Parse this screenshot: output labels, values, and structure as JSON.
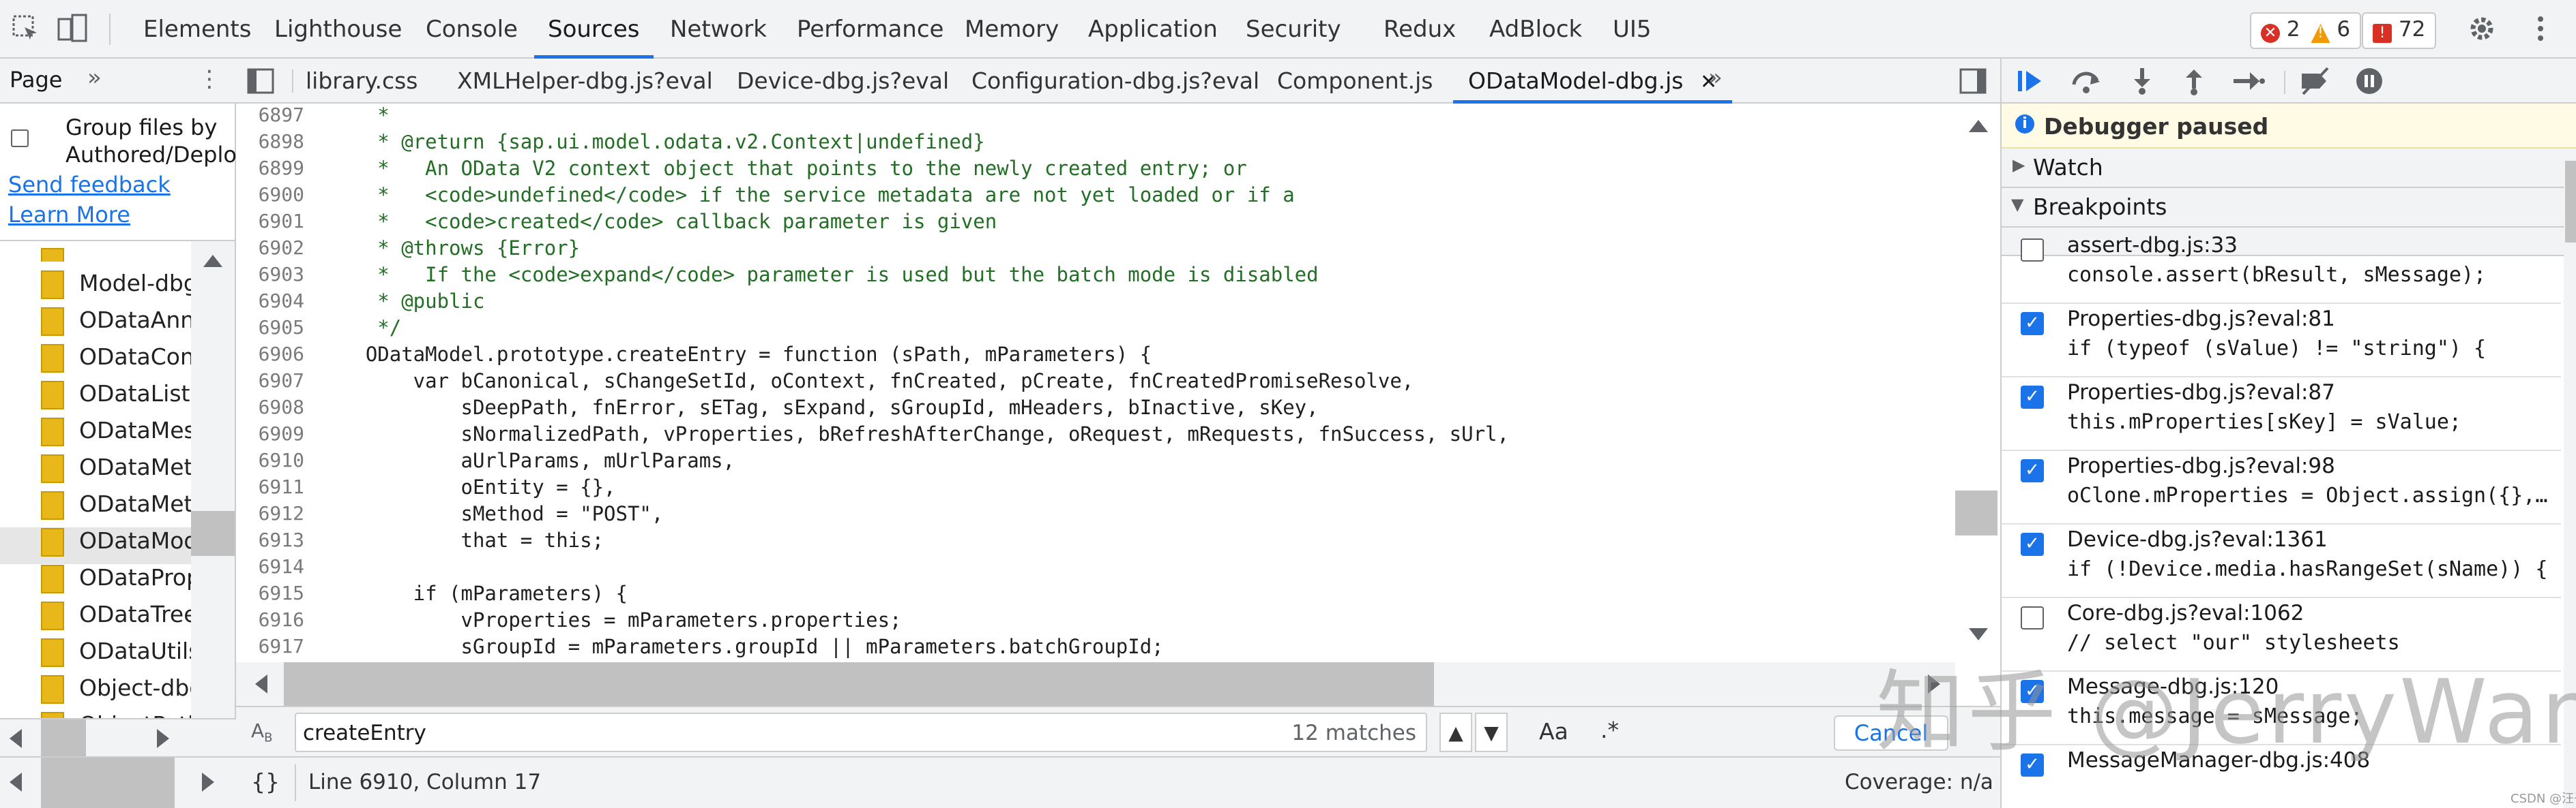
{
  "toolbar": {
    "tabs": [
      "Elements",
      "Lighthouse",
      "Console",
      "Sources",
      "Network",
      "Performance",
      "Memory",
      "Application",
      "Security",
      "Redux",
      "AdBlock",
      "UI5"
    ],
    "active_tab": "Sources",
    "errors": "2",
    "warnings": "6",
    "issues": "72"
  },
  "navigator": {
    "tab": "Page",
    "group_label_1": "Group files by",
    "group_label_2": "Authored/Deploy",
    "send_feedback": "Send feedback",
    "learn_more": "Learn More",
    "files": [
      "Model-dbg",
      "ODataAnn",
      "ODataCon",
      "ODataListB",
      "ODataMes",
      "ODataMet",
      "ODataMet",
      "ODataMod",
      "ODataProp",
      "ODataTree",
      "ODataUtils",
      "Object-dbg",
      "ObjectPath"
    ]
  },
  "editor": {
    "tabs": [
      "library.css",
      "XMLHelper-dbg.js?eval",
      "Device-dbg.js?eval",
      "Configuration-dbg.js?eval",
      "Component.js",
      "ODataModel-dbg.js"
    ],
    "active_tab": "ODataModel-dbg.js",
    "lines": [
      {
        "n": "6897",
        "text": "     *"
      },
      {
        "n": "6898",
        "text": "     * @return {sap.ui.model.odata.v2.Context|undefined}"
      },
      {
        "n": "6899",
        "text": "     *   An OData V2 context object that points to the newly created entry; or"
      },
      {
        "n": "6900",
        "text": "     *   <code>undefined</code> if the service metadata are not yet loaded or if a"
      },
      {
        "n": "6901",
        "text": "     *   <code>created</code> callback parameter is given"
      },
      {
        "n": "6902",
        "text": "     * @throws {Error}"
      },
      {
        "n": "6903",
        "text": "     *   If the <code>expand</code> parameter is used but the batch mode is disabled"
      },
      {
        "n": "6904",
        "text": "     * @public"
      },
      {
        "n": "6905",
        "text": "     */"
      },
      {
        "n": "6906",
        "text": "    ODataModel.prototype.createEntry = function (sPath, mParameters) {"
      },
      {
        "n": "6907",
        "text": "        var bCanonical, sChangeSetId, oContext, fnCreated, pCreate, fnCreatedPromiseResolve,"
      },
      {
        "n": "6908",
        "text": "            sDeepPath, fnError, sETag, sExpand, sGroupId, mHeaders, bInactive, sKey,"
      },
      {
        "n": "6909",
        "text": "            sNormalizedPath, vProperties, bRefreshAfterChange, oRequest, mRequests, fnSuccess, sUrl,"
      },
      {
        "n": "6910",
        "text": "            aUrlParams, mUrlParams,"
      },
      {
        "n": "6911",
        "text": "            oEntity = {},"
      },
      {
        "n": "6912",
        "text": "            sMethod = \"POST\","
      },
      {
        "n": "6913",
        "text": "            that = this;"
      },
      {
        "n": "6914",
        "text": ""
      },
      {
        "n": "6915",
        "text": "        if (mParameters) {"
      },
      {
        "n": "6916",
        "text": "            vProperties = mParameters.properties;"
      },
      {
        "n": "6917",
        "text": "            sGroupId = mParameters.groupId || mParameters.batchGroupId;"
      }
    ],
    "search_value": "createEntry",
    "matches": "12 matches",
    "match_case": "Aa",
    "regex": ".*",
    "cancel": "Cancel",
    "cursor": "Line 6910, Column 17",
    "coverage": "Coverage: n/a",
    "pretty_print": "{}"
  },
  "debugger": {
    "paused": "Debugger paused",
    "watch": "Watch",
    "breakpoints_title": "Breakpoints",
    "breakpoints": [
      {
        "file": "assert-dbg.js:33",
        "code": "console.assert(bResult, sMessage);",
        "checked": false
      },
      {
        "file": "Properties-dbg.js?eval:81",
        "code": "if (typeof (sValue) != \"string\") {",
        "checked": true
      },
      {
        "file": "Properties-dbg.js?eval:87",
        "code": "this.mProperties[sKey] = sValue;",
        "checked": true
      },
      {
        "file": "Properties-dbg.js?eval:98",
        "code": "oClone.mProperties = Object.assign({},…",
        "checked": true
      },
      {
        "file": "Device-dbg.js?eval:1361",
        "code": "if (!Device.media.hasRangeSet(sName)) {",
        "checked": true
      },
      {
        "file": "Core-dbg.js?eval:1062",
        "code": "// select \"our\" stylesheets",
        "checked": false
      },
      {
        "file": "Message-dbg.js:120",
        "code": "this.message = sMessage;",
        "checked": true
      },
      {
        "file": "MessageManager-dbg.js:408",
        "code": "",
        "checked": true
      }
    ]
  },
  "watermark": "知乎 @JerryWang",
  "credit": "CSDN @汪子熙",
  "colors": {
    "accent": "#1a73e8",
    "comment": "#236e25",
    "keyword": "#9a3ca0",
    "string": "#c41a16"
  }
}
